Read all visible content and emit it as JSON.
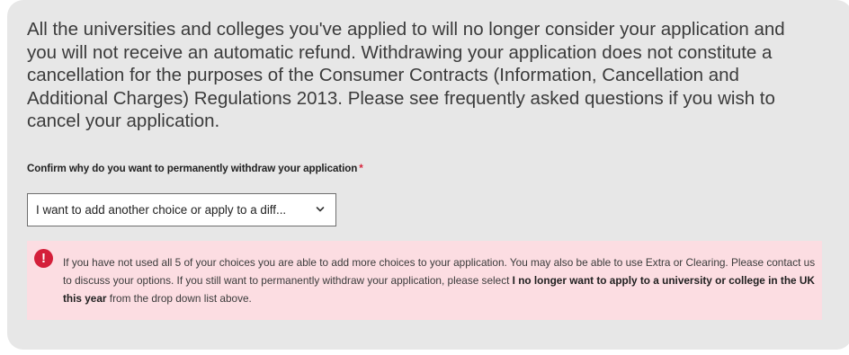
{
  "withdraw": {
    "body_text": "All the universities and colleges you've applied to will no longer consider your application and you will not receive an automatic refund. Withdrawing your application does not constitute a cancellation for the purposes of the Consumer Contracts (Information, Cancellation and Additional Charges) Regulations 2013. Please see frequently asked questions if you wish to cancel your application.",
    "reason_label": "Confirm why do you want to permanently withdraw your application",
    "required_mark": "*",
    "reason_select_value": "I want to add another choice or apply to a diff...",
    "alert": {
      "icon": "!",
      "text_before": "If you have not used all 5 of your choices you are able to add more choices to your application. You may also be able to use Extra or Clearing. Please contact us to discuss your options. If you still want to permanently withdraw your application, please select ",
      "highlight": "I no longer want to apply to a university or college in the UK this year",
      "text_after": " from the drop down list above."
    }
  },
  "colors": {
    "card_background": "#e7e7e7",
    "alert_background": "#fcdde2",
    "alert_icon": "#d41f3a",
    "required": "#d7263d"
  }
}
